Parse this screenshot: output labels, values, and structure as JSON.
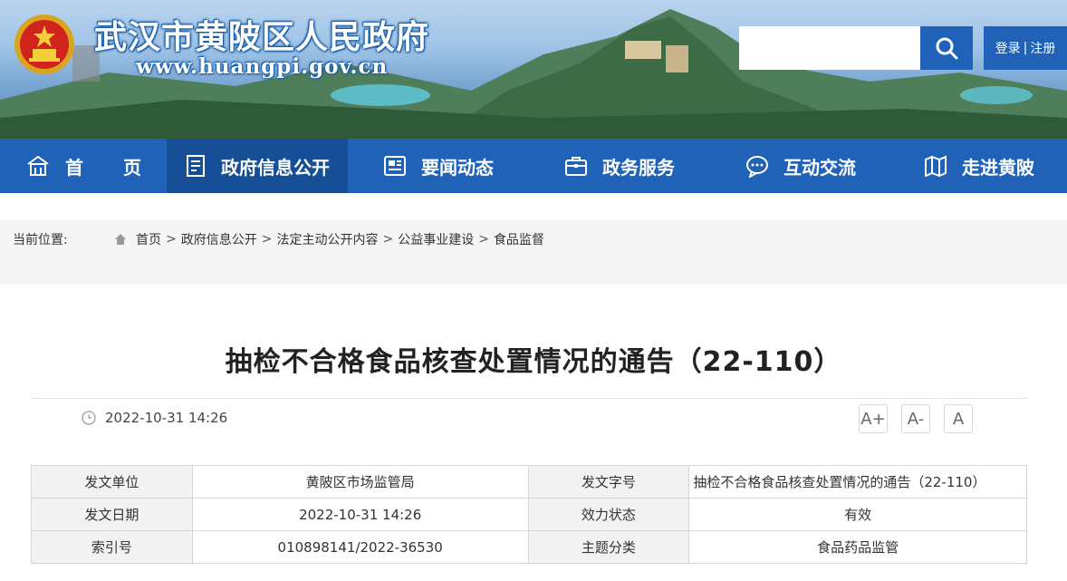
{
  "header": {
    "site_title": "武汉市黄陂区人民政府",
    "site_url": "www.huangpi.gov.cn",
    "search_placeholder": "",
    "login_label": "登录",
    "separator": "|",
    "register_label": "注册"
  },
  "nav": {
    "items": [
      {
        "label": "首页",
        "icon": "home-icon"
      },
      {
        "label": "政府信息公开",
        "icon": "document-icon"
      },
      {
        "label": "要闻动态",
        "icon": "newspaper-icon"
      },
      {
        "label": "政务服务",
        "icon": "briefcase-icon"
      },
      {
        "label": "互动交流",
        "icon": "chat-icon"
      },
      {
        "label": "走进黄陂",
        "icon": "map-icon"
      }
    ],
    "active_index": 1
  },
  "breadcrumb": {
    "prefix": "当前位置:",
    "items": [
      "首页",
      "政府信息公开",
      "法定主动公开内容",
      "公益事业建设",
      "食品监督"
    ],
    "separator": ">"
  },
  "article": {
    "title": "抽检不合格食品核查处置情况的通告（22-110）",
    "date": "2022-10-31 14:26",
    "font_sizes": [
      "A+",
      "A-",
      "A"
    ]
  },
  "info_table": {
    "rows": [
      [
        {
          "k": "发文单位",
          "v": "黄陂区市场监管局"
        },
        {
          "k": "发文字号",
          "v": "抽检不合格食品核查处置情况的通告（22-110）"
        }
      ],
      [
        {
          "k": "发文日期",
          "v": "2022-10-31 14:26"
        },
        {
          "k": "效力状态",
          "v": "有效"
        }
      ],
      [
        {
          "k": "索引号",
          "v": "010898141/2022-36530"
        },
        {
          "k": "主题分类",
          "v": "食品药品监管"
        }
      ]
    ]
  },
  "colors": {
    "nav_blue": "#1f62b7",
    "nav_active": "#174f96",
    "crumb_bg": "#f5f5f5"
  }
}
